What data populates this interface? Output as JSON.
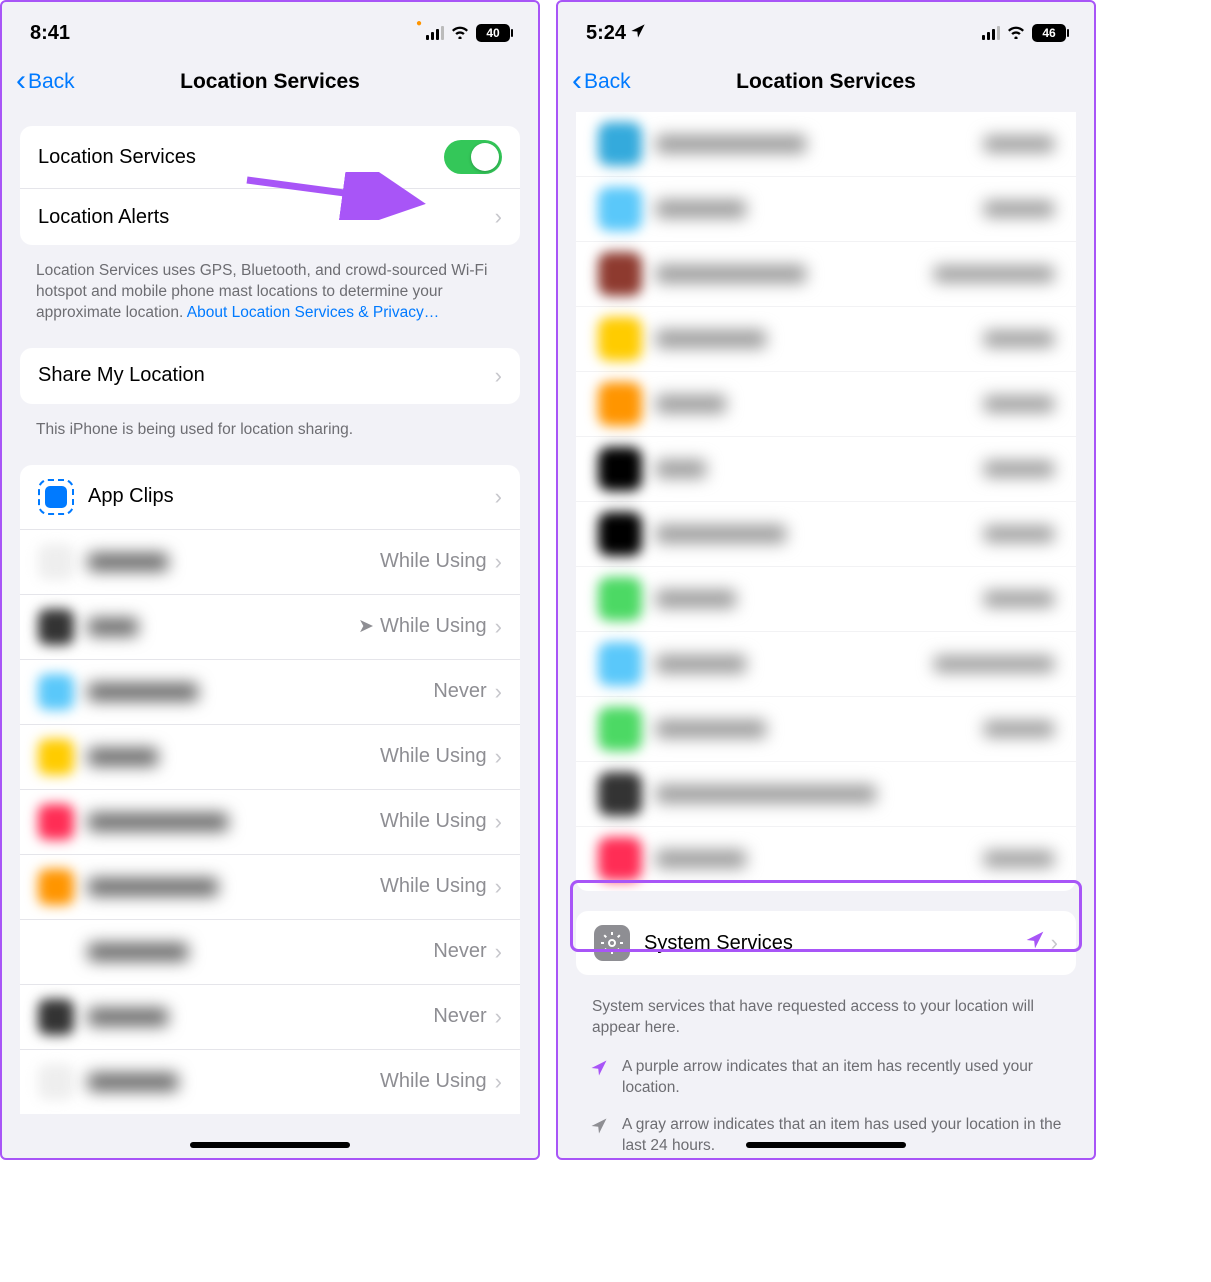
{
  "left": {
    "status": {
      "time": "8:41",
      "battery": "40"
    },
    "nav": {
      "back": "Back",
      "title": "Location Services"
    },
    "rows": {
      "locationServices": "Location Services",
      "locationAlerts": "Location Alerts"
    },
    "footer1a": "Location Services uses GPS, Bluetooth, and crowd-sourced Wi-Fi hotspot and mobile phone mast locations to determine your approximate location. ",
    "footer1link": "About Location Services & Privacy…",
    "shareMyLocation": "Share My Location",
    "footer2": "This iPhone is being used for location sharing.",
    "appClips": "App Clips",
    "statuses": {
      "whileUsing": "While Using",
      "never": "Never"
    }
  },
  "right": {
    "status": {
      "time": "5:24",
      "battery": "46"
    },
    "nav": {
      "back": "Back",
      "title": "Location Services"
    },
    "systemServices": "System Services",
    "footer": "System services that have requested access to your location will appear here.",
    "legend": {
      "purple": "A purple arrow indicates that an item has recently used your location.",
      "gray": "A gray arrow indicates that an item has used your location in the last 24 hours."
    }
  }
}
